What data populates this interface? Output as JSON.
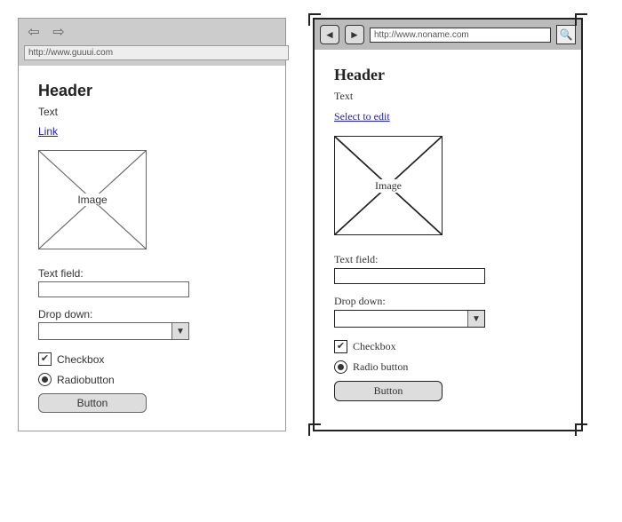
{
  "left": {
    "url": "http://www.guuui.com",
    "header": "Header",
    "text": "Text",
    "link": "Link",
    "image_label": "Image",
    "textfield_label": "Text field:",
    "textfield_value": "",
    "dropdown_label": "Drop down:",
    "dropdown_value": "",
    "checkbox_label": "Checkbox",
    "checkbox_checked": true,
    "radio_label": "Radiobutton",
    "radio_selected": true,
    "button_label": "Button"
  },
  "right": {
    "url": "http://www.noname.com",
    "header": "Header",
    "text": "Text",
    "link": "Select to edit",
    "image_label": "Image",
    "textfield_label": "Text field:",
    "textfield_value": "",
    "dropdown_label": "Drop down:",
    "dropdown_value": "",
    "checkbox_label": "Checkbox",
    "checkbox_checked": true,
    "radio_label": "Radio button",
    "radio_selected": true,
    "button_label": "Button"
  }
}
